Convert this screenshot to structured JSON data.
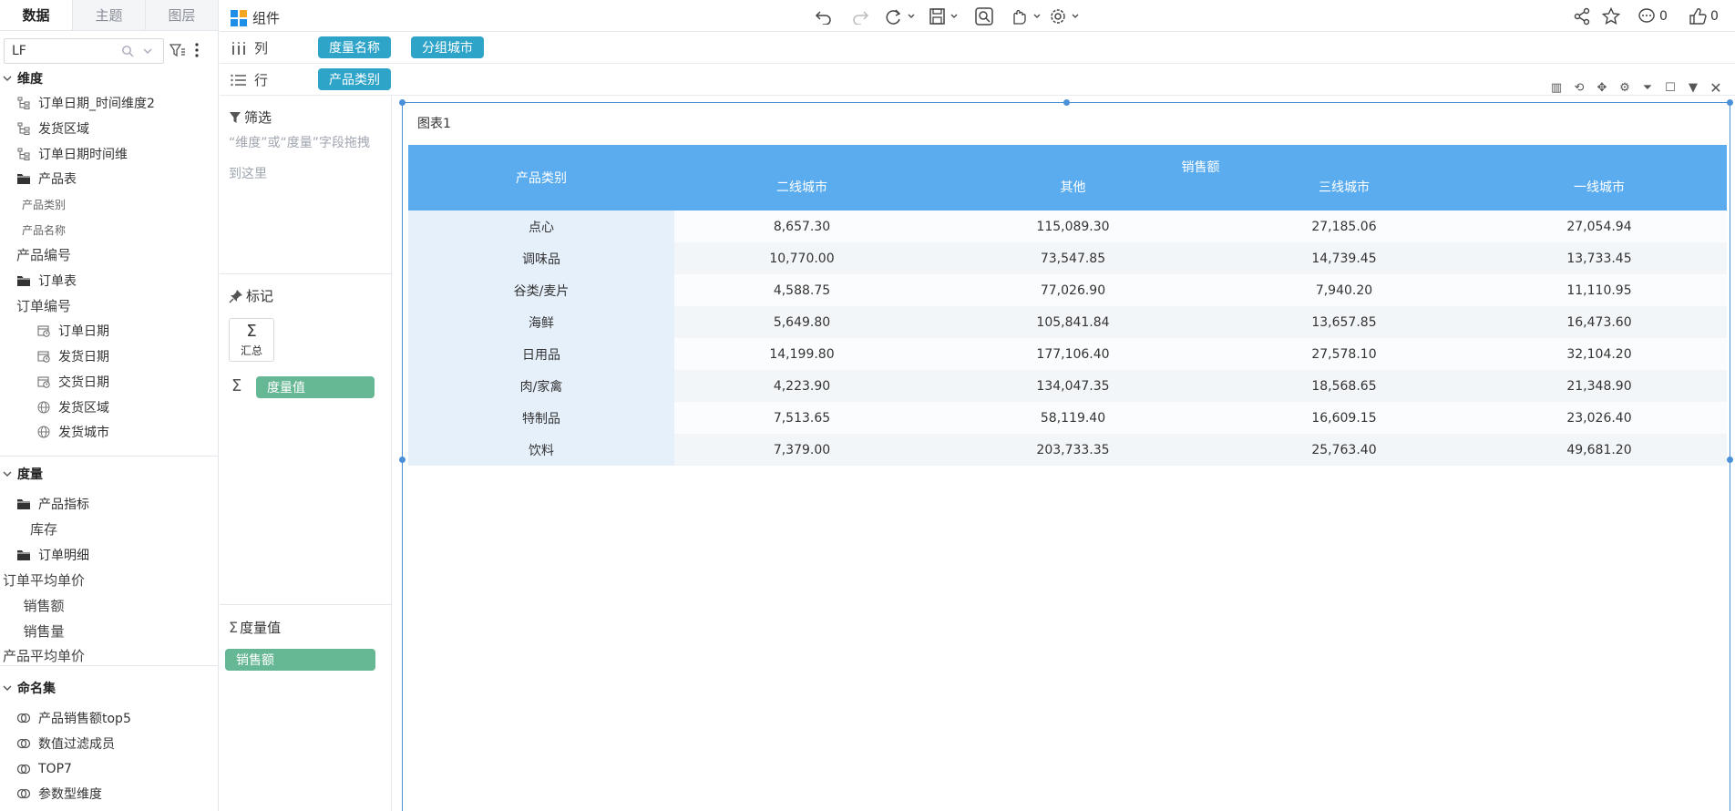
{
  "left_panel": {
    "tabs": [
      {
        "label": "数据",
        "active": true
      },
      {
        "label": "主题",
        "active": false
      },
      {
        "label": "图层",
        "active": false
      }
    ],
    "search": {
      "value": "LF"
    },
    "dimensions": {
      "title": "维度",
      "items": [
        {
          "label": "订单日期_时间维度2",
          "icon": "hierarchy-icon",
          "level": 1
        },
        {
          "label": "发货区域",
          "icon": "hierarchy-icon",
          "level": 1
        },
        {
          "label": "订单日期时间维",
          "icon": "hierarchy-icon",
          "level": 1
        },
        {
          "label": "产品表",
          "icon": "folder-icon",
          "level": 1
        },
        {
          "label": "产品类别",
          "icon": "text-field-icon",
          "level": 2
        },
        {
          "label": "产品名称",
          "icon": "text-field-icon",
          "level": 2
        },
        {
          "label": "产品编号",
          "icon": "number-field-icon",
          "level": 2
        },
        {
          "label": "订单表",
          "icon": "folder-icon",
          "level": 1
        },
        {
          "label": "订单编号",
          "icon": "number-field-icon",
          "level": 2
        },
        {
          "label": "订单日期",
          "icon": "date-field-icon",
          "level": 2
        },
        {
          "label": "发货日期",
          "icon": "date-field-icon",
          "level": 2
        },
        {
          "label": "交货日期",
          "icon": "date-field-icon",
          "level": 2
        },
        {
          "label": "发货区域",
          "icon": "geo-field-icon",
          "level": 2
        },
        {
          "label": "发货城市",
          "icon": "geo-field-icon",
          "level": 2
        }
      ]
    },
    "measures": {
      "title": "度量",
      "items": [
        {
          "label": "产品指标",
          "icon": "folder-icon",
          "level": 1
        },
        {
          "label": "库存",
          "icon": "sum-icon",
          "level": 2
        },
        {
          "label": "订单明细",
          "icon": "folder-icon",
          "level": 1
        },
        {
          "label": "订单平均单价",
          "icon": "sum-icon",
          "level": 2
        },
        {
          "label": "销售额",
          "icon": "sum-icon",
          "level": 2
        },
        {
          "label": "销售量",
          "icon": "sum-icon",
          "level": 2
        },
        {
          "label": "产品平均单价",
          "icon": "sum-icon",
          "level": 2
        }
      ]
    },
    "named_sets": {
      "title": "命名集",
      "items": [
        {
          "label": "产品销售额top5",
          "icon": "named-set-icon"
        },
        {
          "label": "数值过滤成员",
          "icon": "named-set-icon"
        },
        {
          "label": "TOP7",
          "icon": "named-set-icon"
        },
        {
          "label": "参数型维度",
          "icon": "named-set-icon"
        }
      ]
    }
  },
  "toolbar": {
    "component_label": "组件",
    "comment_count": "0",
    "like_count": "0"
  },
  "shelves": {
    "columns": {
      "label": "列",
      "pills": [
        "度量名称",
        "分组城市"
      ]
    },
    "rows": {
      "label": "行",
      "pills": [
        "产品类别"
      ]
    }
  },
  "mid_panel": {
    "filter_title": "筛选",
    "filter_hint": "“维度”或“度量”字段拖拽到这里",
    "marks_title": "标记",
    "summary_label": "汇总",
    "measure_values_pill": "度量值",
    "measure_values_title": "度量值",
    "sales_pill": "销售额"
  },
  "chart": {
    "title": "图表1"
  },
  "chart_data": {
    "type": "table",
    "row_header": "产品类别",
    "column_group": "销售额",
    "columns": [
      "二线城市",
      "其他",
      "三线城市",
      "一线城市"
    ],
    "rows": [
      {
        "category": "点心",
        "values": [
          "8,657.30",
          "115,089.30",
          "27,185.06",
          "27,054.94"
        ]
      },
      {
        "category": "调味品",
        "values": [
          "10,770.00",
          "73,547.85",
          "14,739.45",
          "13,733.45"
        ]
      },
      {
        "category": "谷类/麦片",
        "values": [
          "4,588.75",
          "77,026.90",
          "7,940.20",
          "11,110.95"
        ]
      },
      {
        "category": "海鲜",
        "values": [
          "5,649.80",
          "105,841.84",
          "13,657.85",
          "16,473.60"
        ]
      },
      {
        "category": "日用品",
        "values": [
          "14,199.80",
          "177,106.40",
          "27,578.10",
          "32,104.20"
        ]
      },
      {
        "category": "肉/家禽",
        "values": [
          "4,223.90",
          "134,047.35",
          "18,568.65",
          "21,348.90"
        ]
      },
      {
        "category": "特制品",
        "values": [
          "7,513.65",
          "58,119.40",
          "16,609.15",
          "23,026.40"
        ]
      },
      {
        "category": "饮料",
        "values": [
          "7,379.00",
          "203,733.35",
          "25,763.40",
          "49,681.20"
        ]
      }
    ]
  }
}
